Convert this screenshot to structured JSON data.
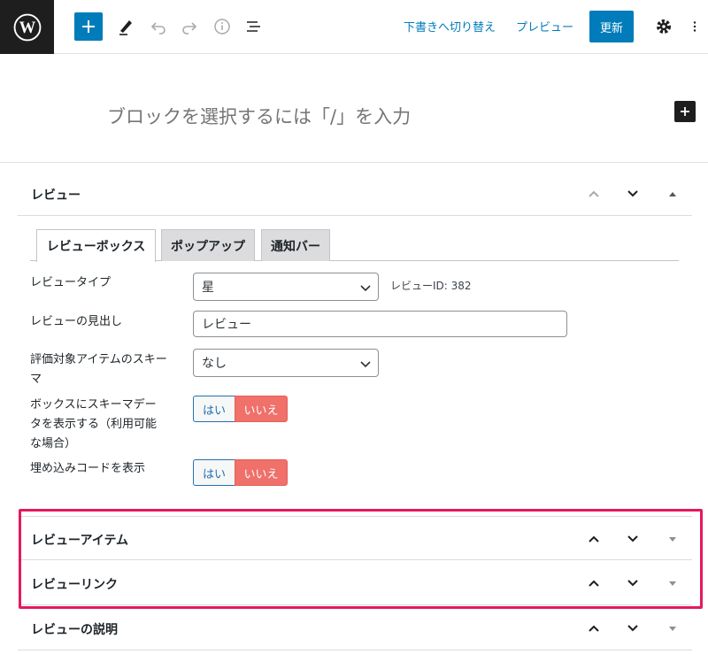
{
  "toolbar": {
    "switch_to_draft": "下書きへ切り替え",
    "preview": "プレビュー",
    "update": "更新"
  },
  "editor": {
    "placeholder": "ブロックを選択するには「/」を入力"
  },
  "review_panel": {
    "title": "レビュー",
    "tabs": [
      "レビューボックス",
      "ポップアップ",
      "通知バー"
    ],
    "fields": {
      "review_type_label": "レビュータイプ",
      "review_type_value": "星",
      "review_id": "レビューID: 382",
      "heading_label": "レビューの見出し",
      "heading_value": "レビュー",
      "schema_label": "評価対象アイテムのスキーマ",
      "schema_value": "なし",
      "show_schema_label": "ボックスにスキーマデータを表示する（利用可能な場合）",
      "show_embed_label": "埋め込みコードを表示",
      "yes": "はい",
      "no": "いいえ"
    }
  },
  "panels": [
    {
      "title": "レビューアイテム"
    },
    {
      "title": "レビューリンク"
    },
    {
      "title": "レビューの説明"
    }
  ],
  "colors": {
    "accent": "#007cba",
    "highlight": "#e5195f",
    "no_button": "#f0706a"
  }
}
